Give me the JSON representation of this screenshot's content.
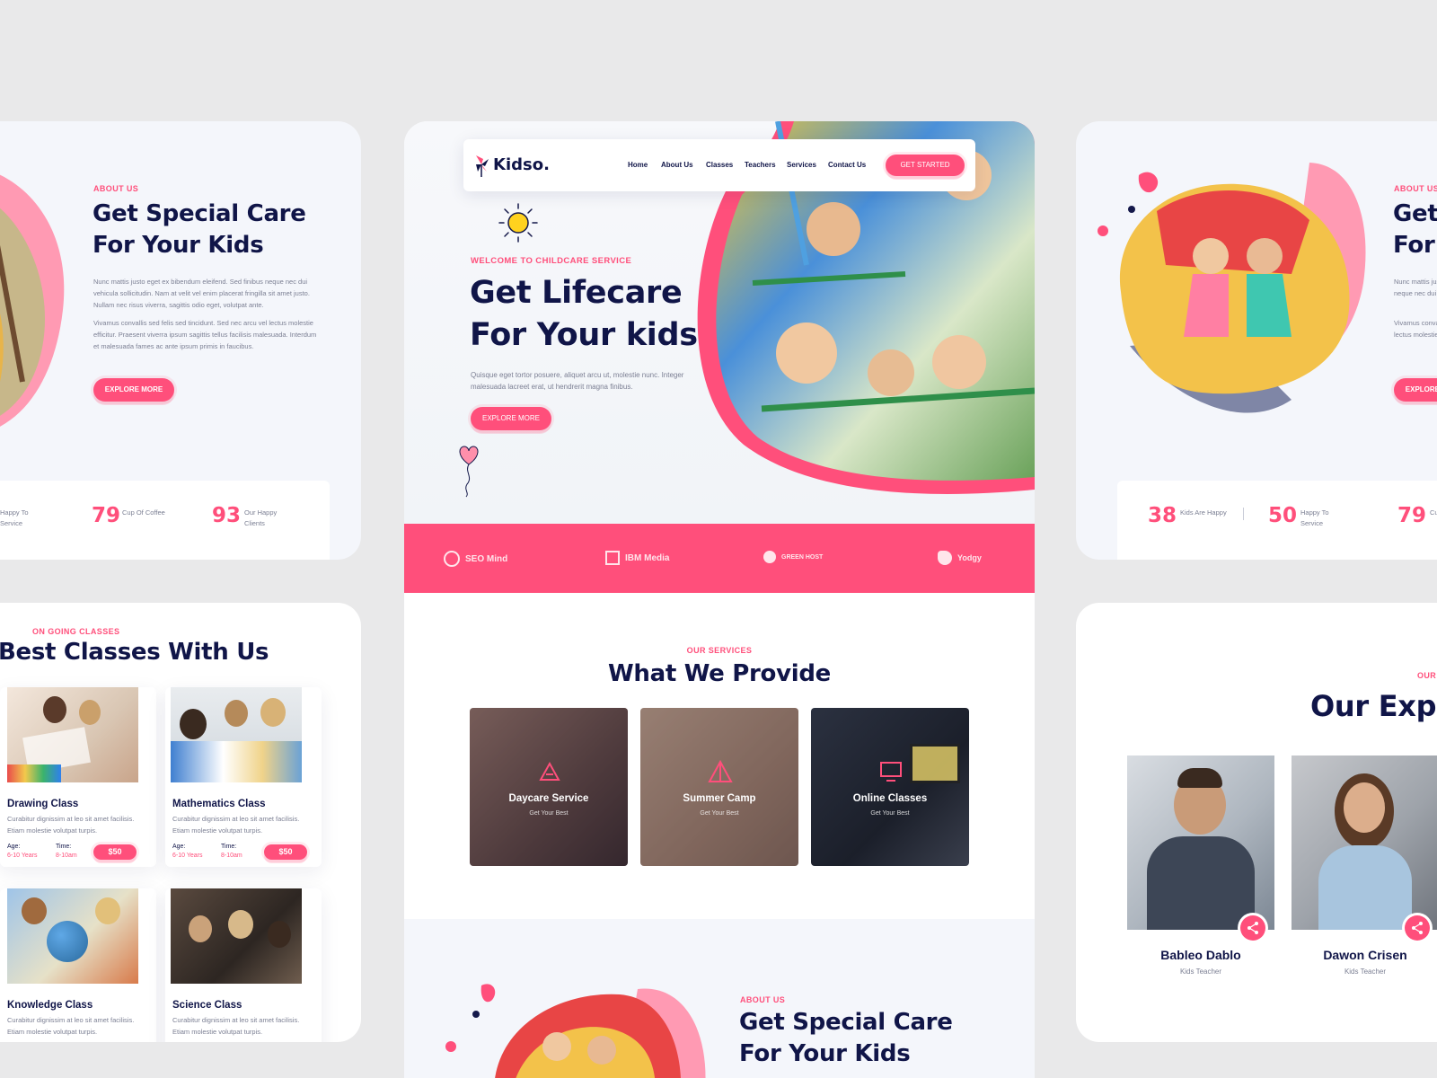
{
  "left_top": {
    "eyebrow": "ABOUT US",
    "title_line1": "Get Special Care",
    "title_line2": "For Your Kids",
    "para1": "Nunc mattis justo eget ex bibendum eleifend. Sed finibus neque nec dui vehicula sollicitudin. Nam at velit vel enim placerat fringilla sit amet justo. Nullam nec risus viverra, sagittis odio eget, volutpat ante.",
    "para2": "Vivamus convallis sed felis sed tincidunt. Sed nec arcu vel lectus molestie efficitur. Praesent viverra ipsum sagittis tellus facilisis malesuada. Interdum et malesuada fames ac ante ipsum primis in faucibus.",
    "button": "EXPLORE MORE",
    "stats": [
      {
        "num": "",
        "label": "Happy To\nService"
      },
      {
        "num": "79",
        "label": "Cup Of Coffee"
      },
      {
        "num": "93",
        "label": "Our Happy\nClients"
      }
    ]
  },
  "left_bottom": {
    "eyebrow": "ON GOING CLASSES",
    "title": "Best Classes With Us",
    "classes": [
      {
        "title": "Drawing Class",
        "desc": "Curabitur dignissim at leo sit amet facilisis. Etiam molestie volutpat turpis.",
        "age_label": "Age:",
        "age": "6-10 Years",
        "time_label": "Time:",
        "time": "8-10am",
        "price": "$50"
      },
      {
        "title": "Mathematics Class",
        "desc": "Curabitur dignissim at leo sit amet facilisis. Etiam molestie volutpat turpis.",
        "age_label": "Age:",
        "age": "6-10 Years",
        "time_label": "Time:",
        "time": "8-10am",
        "price": "$50"
      },
      {
        "title": "Knowledge Class",
        "desc": "Curabitur dignissim at leo sit amet facilisis. Etiam molestie volutpat turpis."
      },
      {
        "title": "Science Class",
        "desc": "Curabitur dignissim at leo sit amet facilisis. Etiam molestie volutpat turpis."
      }
    ]
  },
  "center": {
    "brand": "Kidso.",
    "nav": [
      "Home",
      "About Us",
      "Classes",
      "Teachers",
      "Services",
      "Contact Us"
    ],
    "cta": "GET STARTED",
    "hero_eyebrow": "WELCOME TO CHILDCARE SERVICE",
    "hero_line1": "Get Lifecare",
    "hero_line2": "For Your kids",
    "hero_text": "Quisque eget tortor posuere, aliquet arcu ut, molestie nunc. Integer malesuada lacreet erat, ut hendrerit magna finibus.",
    "hero_button": "EXPLORE MORE",
    "partners": [
      "SEO Mind",
      "IBM Media",
      "GREEN HOST",
      "Yodgy"
    ],
    "services_eyebrow": "OUR SERVICES",
    "services_title": "What We Provide",
    "services": [
      {
        "title": "Daycare Service",
        "sub": "Get Your Best"
      },
      {
        "title": "Summer Camp",
        "sub": "Get Your Best"
      },
      {
        "title": "Online Classes",
        "sub": "Get Your Best"
      }
    ],
    "about_eyebrow": "ABOUT US",
    "about_line1": "Get Special Care",
    "about_line2": "For Your Kids"
  },
  "right_top": {
    "eyebrow": "ABOUT US",
    "title_line1": "Get",
    "title_line2": "For",
    "para1": "Nunc mattis justo eget ex bibendum eleifend. Sed finibus neque nec dui vehicula sollicitudin. Nullam",
    "para2": "Vivamus convallis sed felis sed tincidunt. Sed nec arcu vel lectus molestie efficitur. Interdum faucibus.",
    "button": "EXPLORE MORE",
    "stats": [
      {
        "num": "38",
        "label": "Kids Are Happy"
      },
      {
        "num": "50",
        "label": "Happy To\nService"
      },
      {
        "num": "79",
        "label": "Cup"
      }
    ]
  },
  "right_bottom": {
    "eyebrow": "OUR",
    "title": "Our Exp",
    "teachers": [
      {
        "name": "Bableo Dablo",
        "role": "Kids Teacher"
      },
      {
        "name": "Dawon Crisen",
        "role": "Kids Teacher"
      }
    ]
  },
  "colors": {
    "accent": "#ff4f7b",
    "navy": "#101548",
    "background": "#e9e9ea"
  }
}
